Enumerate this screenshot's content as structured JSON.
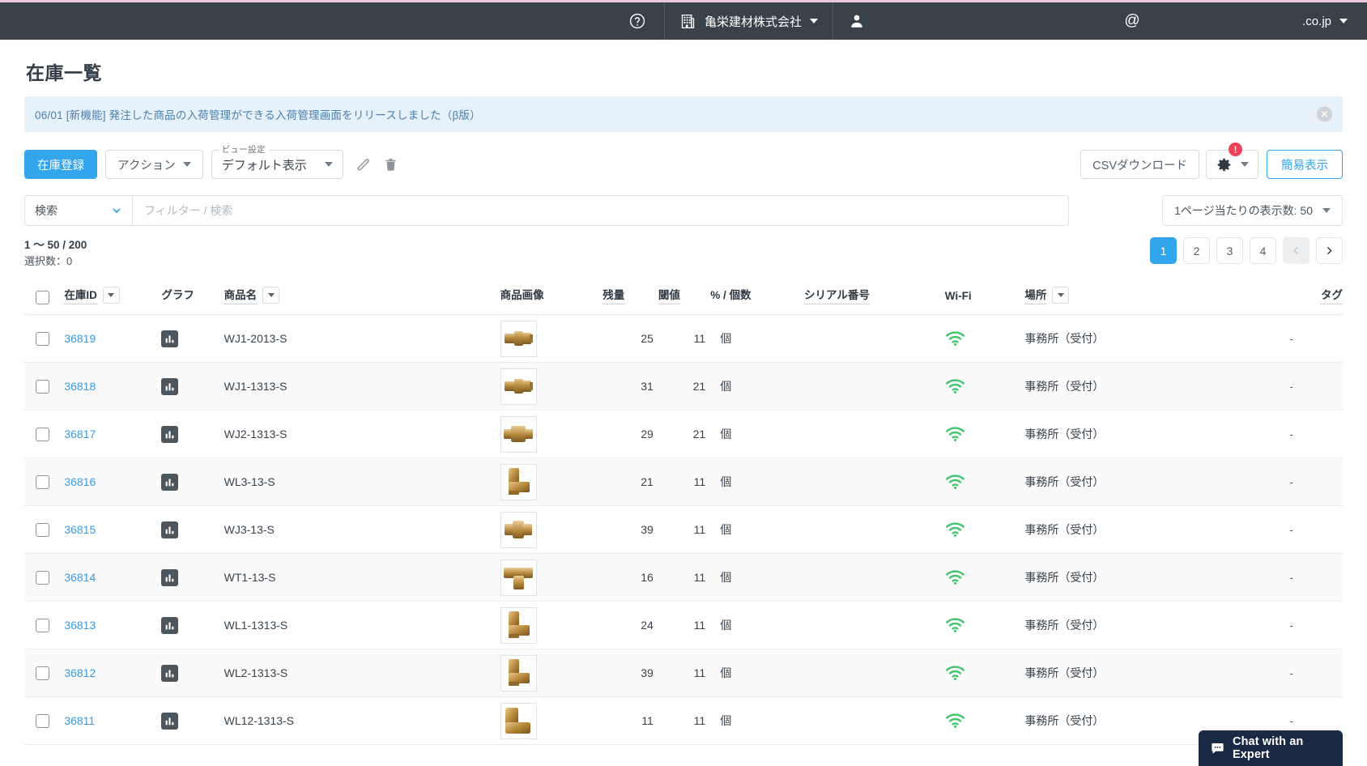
{
  "header": {
    "help_icon": "help-circle-icon",
    "company_icon": "building-icon",
    "company_name": "亀栄建材株式会社",
    "company_caret": "chevron-down-icon",
    "user_icon": "person-icon",
    "user_name": "",
    "at_symbol": "@",
    "domain_text": ".co.jp",
    "domain_caret": "chevron-down-icon"
  },
  "page": {
    "title": "在庫一覧"
  },
  "notice": {
    "text": "06/01 [新機能] 発注した商品の入荷管理ができる入荷管理画面をリリースしました（β版）",
    "close_icon": "close-icon",
    "close_label": "✕"
  },
  "toolbar": {
    "register_label": "在庫登録",
    "action_label": "アクション",
    "view_legend": "ビュー設定",
    "view_value": "デフォルト表示",
    "edit_icon": "pencil-icon",
    "delete_icon": "trash-icon",
    "csv_label": "CSVダウンロード",
    "gear_icon": "gear-icon",
    "gear_badge": "!",
    "simple_view_label": "簡易表示"
  },
  "filters": {
    "search_select_value": "検索",
    "search_placeholder": "フィルター / 検索",
    "search_value": "",
    "per_page_label": "1ページ当たりの表示数: 50"
  },
  "summary": {
    "range": "1 〜 50 / 200",
    "selected": "選択数：0"
  },
  "pagination": {
    "pages": [
      "1",
      "2",
      "3",
      "4"
    ],
    "active": "1",
    "prev_icon": "chevron-left-icon",
    "next_icon": "chevron-right-icon"
  },
  "table": {
    "columns": [
      {
        "label": "",
        "sortable": false,
        "dropdown": false
      },
      {
        "label": "在庫ID",
        "sortable": true,
        "dropdown": true
      },
      {
        "label": "グラフ",
        "sortable": false,
        "dropdown": false
      },
      {
        "label": "商品名",
        "sortable": true,
        "dropdown": true
      },
      {
        "label": "商品画像",
        "sortable": false,
        "dropdown": false
      },
      {
        "label": "残量",
        "sortable": true,
        "dropdown": false
      },
      {
        "label": "閾値",
        "sortable": true,
        "dropdown": false
      },
      {
        "label": "% / 個数",
        "sortable": false,
        "dropdown": false
      },
      {
        "label": "シリアル番号",
        "sortable": true,
        "dropdown": false
      },
      {
        "label": "Wi-Fi",
        "sortable": false,
        "dropdown": false
      },
      {
        "label": "場所",
        "sortable": true,
        "dropdown": true
      },
      {
        "label": "タグ",
        "sortable": true,
        "dropdown": false
      }
    ],
    "rows": [
      {
        "id": "36819",
        "name": "WJ1-2013-S",
        "remaining": "25",
        "threshold": "11",
        "unit": "個",
        "serial": "",
        "wifi": "wifi-icon",
        "location": "事務所（受付）",
        "tag": "-",
        "image": "brass-fitting"
      },
      {
        "id": "36818",
        "name": "WJ1-1313-S",
        "remaining": "31",
        "threshold": "21",
        "unit": "個",
        "serial": "",
        "wifi": "wifi-icon",
        "location": "事務所（受付）",
        "tag": "-",
        "image": "brass-fitting"
      },
      {
        "id": "36817",
        "name": "WJ2-1313-S",
        "remaining": "29",
        "threshold": "21",
        "unit": "個",
        "serial": "",
        "wifi": "wifi-icon",
        "location": "事務所（受付）",
        "tag": "-",
        "image": "brass-coupler"
      },
      {
        "id": "36816",
        "name": "WL3-13-S",
        "remaining": "21",
        "threshold": "11",
        "unit": "個",
        "serial": "",
        "wifi": "wifi-icon",
        "location": "事務所（受付）",
        "tag": "-",
        "image": "brass-elbow"
      },
      {
        "id": "36815",
        "name": "WJ3-13-S",
        "remaining": "39",
        "threshold": "11",
        "unit": "個",
        "serial": "",
        "wifi": "wifi-icon",
        "location": "事務所（受付）",
        "tag": "-",
        "image": "brass-socket"
      },
      {
        "id": "36814",
        "name": "WT1-13-S",
        "remaining": "16",
        "threshold": "11",
        "unit": "個",
        "serial": "",
        "wifi": "wifi-icon",
        "location": "事務所（受付）",
        "tag": "-",
        "image": "brass-tee"
      },
      {
        "id": "36813",
        "name": "WL1-1313-S",
        "remaining": "24",
        "threshold": "11",
        "unit": "個",
        "serial": "",
        "wifi": "wifi-icon",
        "location": "事務所（受付）",
        "tag": "-",
        "image": "brass-elbow"
      },
      {
        "id": "36812",
        "name": "WL2-1313-S",
        "remaining": "39",
        "threshold": "11",
        "unit": "個",
        "serial": "",
        "wifi": "wifi-icon",
        "location": "事務所（受付）",
        "tag": "-",
        "image": "brass-elbow"
      },
      {
        "id": "36811",
        "name": "WL12-1313-S",
        "remaining": "11",
        "threshold": "11",
        "unit": "個",
        "serial": "",
        "wifi": "wifi-icon",
        "location": "事務所（受付）",
        "tag": "-",
        "image": "brass-elbow-large"
      }
    ]
  },
  "chat": {
    "icon": "chat-bubble-icon",
    "label": "Chat with an Expert"
  },
  "colors": {
    "accent": "#32a5ec",
    "topbar": "#3a4249",
    "notice_bg": "#e7f1f9",
    "notice_text": "#4a7fb0",
    "badge": "#ef4056",
    "wifi": "#3fc36b",
    "chat_bg": "#1b2a44"
  }
}
